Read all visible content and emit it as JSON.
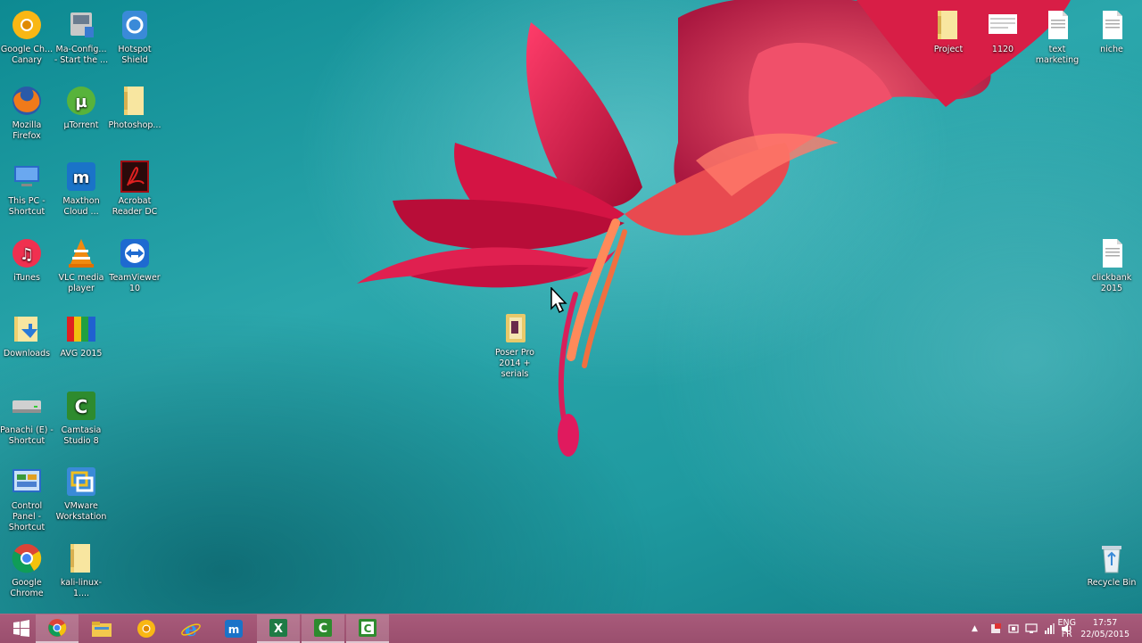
{
  "desktop": {
    "left_icons": [
      {
        "label": "Google Ch... Canary",
        "icon": "chrome-canary-icon"
      },
      {
        "label": "Ma-Config... - Start the ...",
        "icon": "ma-config-icon"
      },
      {
        "label": "Hotspot Shield",
        "icon": "hotspot-shield-icon"
      },
      {
        "label": "Mozilla Firefox",
        "icon": "firefox-icon"
      },
      {
        "label": "µTorrent",
        "icon": "utorrent-icon"
      },
      {
        "label": "Photoshop...",
        "icon": "folder-icon"
      },
      {
        "label": "This PC - Shortcut",
        "icon": "this-pc-icon"
      },
      {
        "label": "Maxthon Cloud ...",
        "icon": "maxthon-icon"
      },
      {
        "label": "Acrobat Reader DC",
        "icon": "acrobat-icon"
      },
      {
        "label": "iTunes",
        "icon": "itunes-icon"
      },
      {
        "label": "VLC media player",
        "icon": "vlc-icon"
      },
      {
        "label": "TeamViewer 10",
        "icon": "teamviewer-icon"
      },
      {
        "label": "Downloads",
        "icon": "downloads-folder-icon"
      },
      {
        "label": "AVG 2015",
        "icon": "avg-icon"
      },
      {
        "label": "Panachi (E) - Shortcut",
        "icon": "drive-icon"
      },
      {
        "label": "Camtasia Studio 8",
        "icon": "camtasia-icon"
      },
      {
        "label": "Control Panel - Shortcut",
        "icon": "control-panel-icon"
      },
      {
        "label": "VMware Workstation",
        "icon": "vmware-icon"
      },
      {
        "label": "Google Chrome",
        "icon": "chrome-icon"
      },
      {
        "label": "kali-linux-1....",
        "icon": "folder-icon"
      }
    ],
    "right_icons": [
      {
        "label": "Project",
        "icon": "folder-icon"
      },
      {
        "label": "1120",
        "icon": "document-icon"
      },
      {
        "label": "text marketing",
        "icon": "text-file-icon"
      },
      {
        "label": "niche",
        "icon": "text-file-icon"
      },
      {
        "label": "clickbank 2015",
        "icon": "text-file-icon"
      },
      {
        "label": "Recycle Bin",
        "icon": "recycle-bin-icon"
      }
    ],
    "center_icon": {
      "label": "Poser Pro 2014 + serials",
      "icon": "archive-folder-icon"
    }
  },
  "taskbar": {
    "apps": [
      {
        "name": "start",
        "icon": "windows-logo-icon"
      },
      {
        "name": "chrome",
        "icon": "chrome-icon"
      },
      {
        "name": "explorer",
        "icon": "file-explorer-icon"
      },
      {
        "name": "canary",
        "icon": "chrome-canary-icon"
      },
      {
        "name": "ie",
        "icon": "internet-explorer-icon"
      },
      {
        "name": "maxthon",
        "icon": "maxthon-icon"
      },
      {
        "name": "excel",
        "icon": "excel-icon"
      },
      {
        "name": "camtasia-recorder",
        "icon": "camtasia-icon"
      },
      {
        "name": "camtasia-studio",
        "icon": "camtasia-icon"
      }
    ],
    "language_top": "ENG",
    "language_bottom": "FR",
    "time": "17:57",
    "date": "22/05/2015"
  },
  "colors": {
    "taskbar": "#9a4f6e",
    "wallpaper": "#1f9aa0",
    "flower": "#e0244a"
  }
}
